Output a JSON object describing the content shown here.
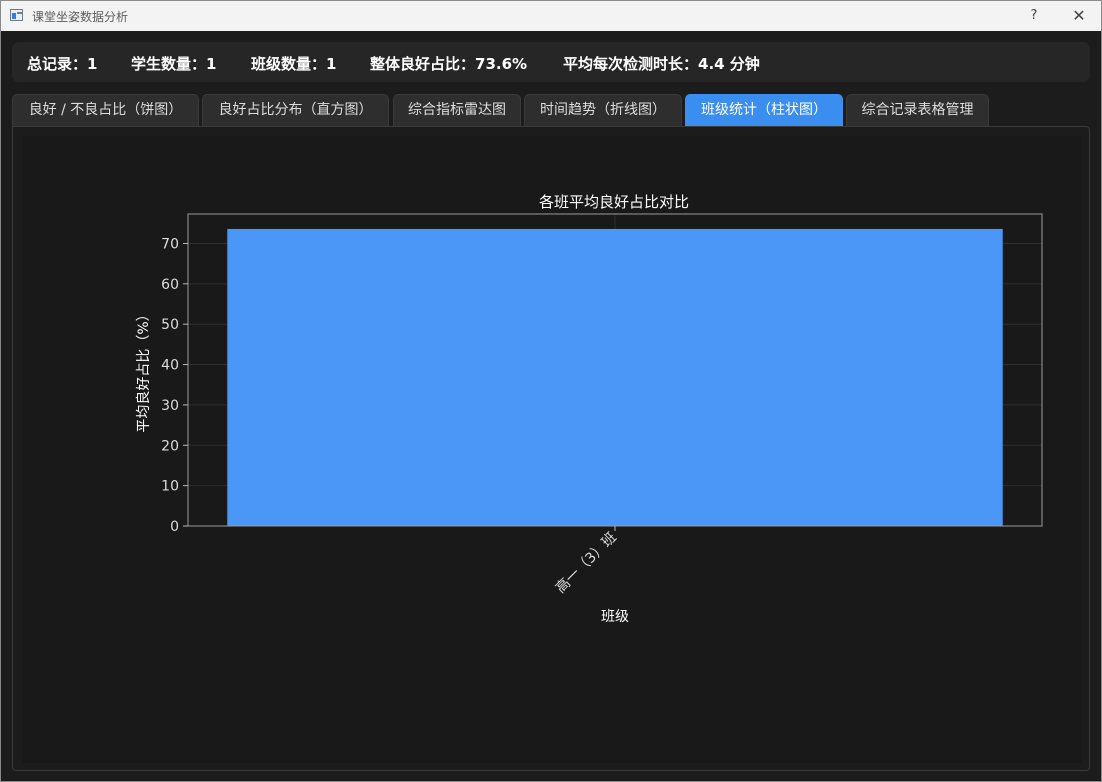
{
  "window": {
    "title": "课堂坐姿数据分析",
    "help_label": "?",
    "close_label": "✕"
  },
  "stats": {
    "total_records": "总记录：1",
    "student_count": "学生数量：1",
    "class_count": "班级数量：1",
    "overall_good_ratio": "整体良好占比：73.6%",
    "avg_duration": "平均每次检测时长：4.4 分钟"
  },
  "tabs": [
    {
      "label": "良好 / 不良占比（饼图）",
      "active": false
    },
    {
      "label": "良好占比分布（直方图）",
      "active": false
    },
    {
      "label": "综合指标雷达图",
      "active": false
    },
    {
      "label": "时间趋势（折线图）",
      "active": false
    },
    {
      "label": "班级统计（柱状图）",
      "active": true
    },
    {
      "label": "综合记录表格管理",
      "active": false
    }
  ],
  "chart_data": {
    "type": "bar",
    "title": "各班平均良好占比对比",
    "xlabel": "班级",
    "ylabel": "平均良好占比（%）",
    "categories": [
      "高一（3）班"
    ],
    "values": [
      73.6
    ],
    "ylim": [
      0,
      77.3
    ],
    "yticks": [
      0,
      10,
      20,
      30,
      40,
      50,
      60,
      70
    ],
    "grid": true,
    "bar_color": "#4a97f7"
  },
  "colors": {
    "accent": "#3a8ef0",
    "background": "#1c1c1c",
    "stats_bar": "#262626"
  }
}
